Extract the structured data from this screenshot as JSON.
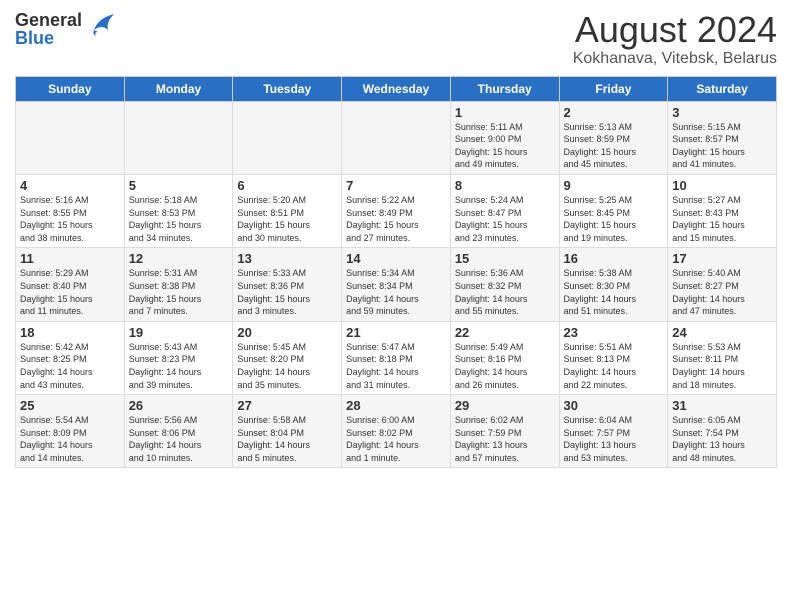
{
  "logo": {
    "general": "General",
    "blue": "Blue"
  },
  "title": "August 2024",
  "subtitle": "Kokhanava, Vitebsk, Belarus",
  "days_of_week": [
    "Sunday",
    "Monday",
    "Tuesday",
    "Wednesday",
    "Thursday",
    "Friday",
    "Saturday"
  ],
  "weeks": [
    [
      {
        "day": "",
        "info": ""
      },
      {
        "day": "",
        "info": ""
      },
      {
        "day": "",
        "info": ""
      },
      {
        "day": "",
        "info": ""
      },
      {
        "day": "1",
        "info": "Sunrise: 5:11 AM\nSunset: 9:00 PM\nDaylight: 15 hours\nand 49 minutes."
      },
      {
        "day": "2",
        "info": "Sunrise: 5:13 AM\nSunset: 8:59 PM\nDaylight: 15 hours\nand 45 minutes."
      },
      {
        "day": "3",
        "info": "Sunrise: 5:15 AM\nSunset: 8:57 PM\nDaylight: 15 hours\nand 41 minutes."
      }
    ],
    [
      {
        "day": "4",
        "info": "Sunrise: 5:16 AM\nSunset: 8:55 PM\nDaylight: 15 hours\nand 38 minutes."
      },
      {
        "day": "5",
        "info": "Sunrise: 5:18 AM\nSunset: 8:53 PM\nDaylight: 15 hours\nand 34 minutes."
      },
      {
        "day": "6",
        "info": "Sunrise: 5:20 AM\nSunset: 8:51 PM\nDaylight: 15 hours\nand 30 minutes."
      },
      {
        "day": "7",
        "info": "Sunrise: 5:22 AM\nSunset: 8:49 PM\nDaylight: 15 hours\nand 27 minutes."
      },
      {
        "day": "8",
        "info": "Sunrise: 5:24 AM\nSunset: 8:47 PM\nDaylight: 15 hours\nand 23 minutes."
      },
      {
        "day": "9",
        "info": "Sunrise: 5:25 AM\nSunset: 8:45 PM\nDaylight: 15 hours\nand 19 minutes."
      },
      {
        "day": "10",
        "info": "Sunrise: 5:27 AM\nSunset: 8:43 PM\nDaylight: 15 hours\nand 15 minutes."
      }
    ],
    [
      {
        "day": "11",
        "info": "Sunrise: 5:29 AM\nSunset: 8:40 PM\nDaylight: 15 hours\nand 11 minutes."
      },
      {
        "day": "12",
        "info": "Sunrise: 5:31 AM\nSunset: 8:38 PM\nDaylight: 15 hours\nand 7 minutes."
      },
      {
        "day": "13",
        "info": "Sunrise: 5:33 AM\nSunset: 8:36 PM\nDaylight: 15 hours\nand 3 minutes."
      },
      {
        "day": "14",
        "info": "Sunrise: 5:34 AM\nSunset: 8:34 PM\nDaylight: 14 hours\nand 59 minutes."
      },
      {
        "day": "15",
        "info": "Sunrise: 5:36 AM\nSunset: 8:32 PM\nDaylight: 14 hours\nand 55 minutes."
      },
      {
        "day": "16",
        "info": "Sunrise: 5:38 AM\nSunset: 8:30 PM\nDaylight: 14 hours\nand 51 minutes."
      },
      {
        "day": "17",
        "info": "Sunrise: 5:40 AM\nSunset: 8:27 PM\nDaylight: 14 hours\nand 47 minutes."
      }
    ],
    [
      {
        "day": "18",
        "info": "Sunrise: 5:42 AM\nSunset: 8:25 PM\nDaylight: 14 hours\nand 43 minutes."
      },
      {
        "day": "19",
        "info": "Sunrise: 5:43 AM\nSunset: 8:23 PM\nDaylight: 14 hours\nand 39 minutes."
      },
      {
        "day": "20",
        "info": "Sunrise: 5:45 AM\nSunset: 8:20 PM\nDaylight: 14 hours\nand 35 minutes."
      },
      {
        "day": "21",
        "info": "Sunrise: 5:47 AM\nSunset: 8:18 PM\nDaylight: 14 hours\nand 31 minutes."
      },
      {
        "day": "22",
        "info": "Sunrise: 5:49 AM\nSunset: 8:16 PM\nDaylight: 14 hours\nand 26 minutes."
      },
      {
        "day": "23",
        "info": "Sunrise: 5:51 AM\nSunset: 8:13 PM\nDaylight: 14 hours\nand 22 minutes."
      },
      {
        "day": "24",
        "info": "Sunrise: 5:53 AM\nSunset: 8:11 PM\nDaylight: 14 hours\nand 18 minutes."
      }
    ],
    [
      {
        "day": "25",
        "info": "Sunrise: 5:54 AM\nSunset: 8:09 PM\nDaylight: 14 hours\nand 14 minutes."
      },
      {
        "day": "26",
        "info": "Sunrise: 5:56 AM\nSunset: 8:06 PM\nDaylight: 14 hours\nand 10 minutes."
      },
      {
        "day": "27",
        "info": "Sunrise: 5:58 AM\nSunset: 8:04 PM\nDaylight: 14 hours\nand 5 minutes."
      },
      {
        "day": "28",
        "info": "Sunrise: 6:00 AM\nSunset: 8:02 PM\nDaylight: 14 hours\nand 1 minute."
      },
      {
        "day": "29",
        "info": "Sunrise: 6:02 AM\nSunset: 7:59 PM\nDaylight: 13 hours\nand 57 minutes."
      },
      {
        "day": "30",
        "info": "Sunrise: 6:04 AM\nSunset: 7:57 PM\nDaylight: 13 hours\nand 53 minutes."
      },
      {
        "day": "31",
        "info": "Sunrise: 6:05 AM\nSunset: 7:54 PM\nDaylight: 13 hours\nand 48 minutes."
      }
    ]
  ]
}
